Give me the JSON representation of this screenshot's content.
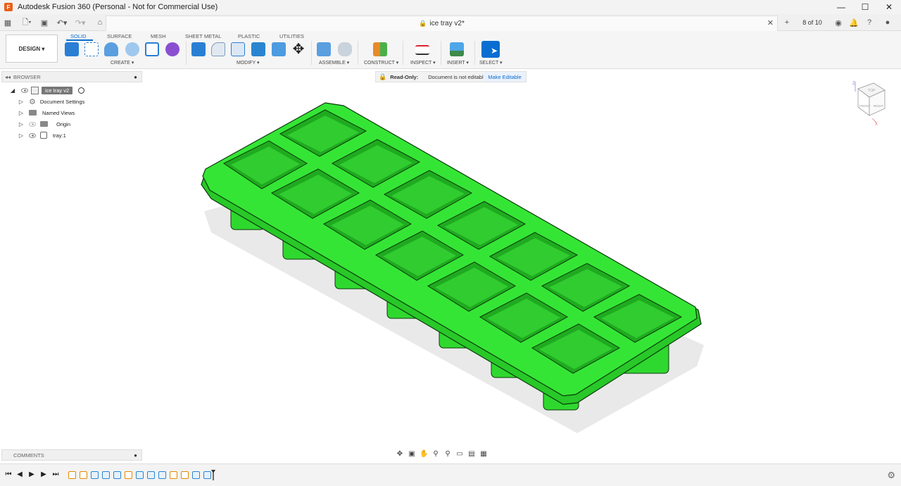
{
  "titlebar": {
    "title": "Autodesk Fusion 360 (Personal - Not for Commercial Use)"
  },
  "tabbar": {
    "doc_title": "ice tray v2*",
    "job_status": "8 of 10"
  },
  "toolbar": {
    "mode": "DESIGN",
    "tabs": [
      "SOLID",
      "SURFACE",
      "MESH",
      "SHEET METAL",
      "PLASTIC",
      "UTILITIES"
    ],
    "groups": [
      "CREATE",
      "MODIFY",
      "ASSEMBLE",
      "CONSTRUCT",
      "INSPECT",
      "INSERT",
      "SELECT"
    ]
  },
  "browser": {
    "header": "BROWSER",
    "root": "ice tray v2",
    "items": [
      "Document Settings",
      "Named Views",
      "Origin",
      "tray:1"
    ]
  },
  "banner": {
    "readonly": "Read-Only:",
    "message": "Document is not editable",
    "action": "Make Editable"
  },
  "comments": {
    "label": "COMMENTS"
  },
  "viewcube": {
    "top": "TOP",
    "front": "FRONT",
    "right": "RIGHT",
    "axis_z": "Z",
    "axis_x": "X"
  },
  "colors": {
    "accent": "#0a6ed1",
    "model": "#2ee02e"
  }
}
